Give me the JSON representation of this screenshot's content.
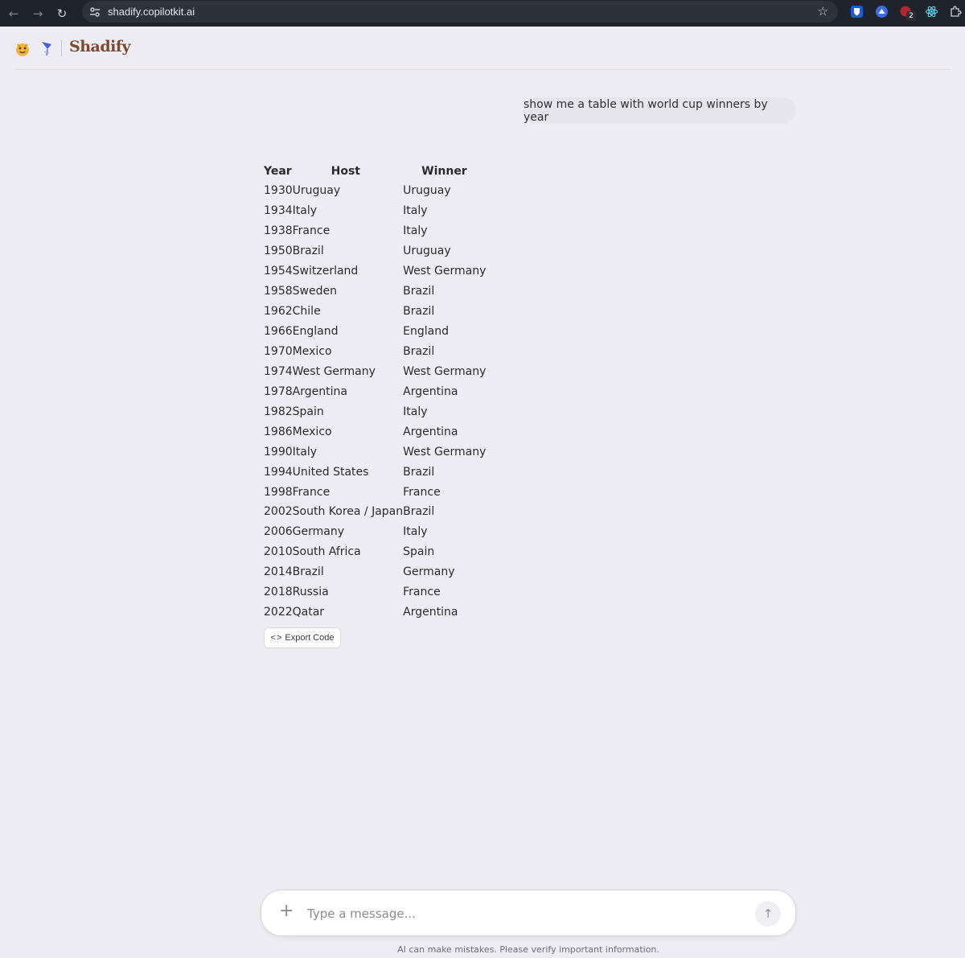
{
  "browser": {
    "url": "shadify.copilotkit.ai",
    "extension_badge": "2"
  },
  "app": {
    "brand": "Shadify"
  },
  "chat": {
    "user_message": "show me a table with world cup winners by year"
  },
  "table": {
    "headers": [
      "Year",
      "Host",
      "Winner"
    ],
    "rows": [
      [
        "1930",
        "Uruguay",
        "Uruguay"
      ],
      [
        "1934",
        "Italy",
        "Italy"
      ],
      [
        "1938",
        "France",
        "Italy"
      ],
      [
        "1950",
        "Brazil",
        "Uruguay"
      ],
      [
        "1954",
        "Switzerland",
        "West Germany"
      ],
      [
        "1958",
        "Sweden",
        "Brazil"
      ],
      [
        "1962",
        "Chile",
        "Brazil"
      ],
      [
        "1966",
        "England",
        "England"
      ],
      [
        "1970",
        "Mexico",
        "Brazil"
      ],
      [
        "1974",
        "West Germany",
        "West Germany"
      ],
      [
        "1978",
        "Argentina",
        "Argentina"
      ],
      [
        "1982",
        "Spain",
        "Italy"
      ],
      [
        "1986",
        "Mexico",
        "Argentina"
      ],
      [
        "1990",
        "Italy",
        "West Germany"
      ],
      [
        "1994",
        "United States",
        "Brazil"
      ],
      [
        "1998",
        "France",
        "France"
      ],
      [
        "2002",
        "South Korea / Japan",
        "Brazil"
      ],
      [
        "2006",
        "Germany",
        "Italy"
      ],
      [
        "2010",
        "South Africa",
        "Spain"
      ],
      [
        "2014",
        "Brazil",
        "Germany"
      ],
      [
        "2018",
        "Russia",
        "France"
      ],
      [
        "2022",
        "Qatar",
        "Argentina"
      ]
    ],
    "export_label": "Export Code"
  },
  "composer": {
    "placeholder": "Type a message...",
    "disclaimer": "AI can make mistakes. Please verify important information."
  },
  "colors": {
    "page_bg": "#eeecf3",
    "chrome_bg": "#1f232b",
    "brand": "#7a4a33"
  }
}
